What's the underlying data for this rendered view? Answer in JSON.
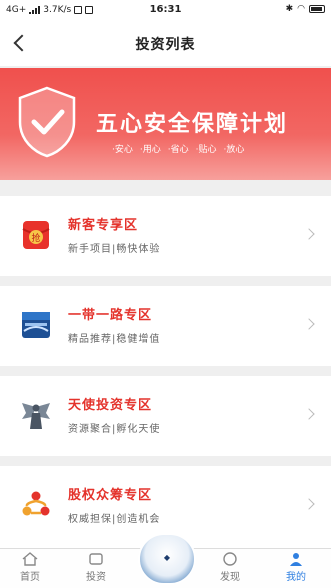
{
  "status_bar": {
    "network": "4G+",
    "speed": "3.7K/s",
    "time": "16:31"
  },
  "nav": {
    "title": "投资列表"
  },
  "banner": {
    "title": "五心安全保障计划",
    "tags": [
      "·安心",
      "·用心",
      "·省心",
      "·贴心",
      "·放心"
    ]
  },
  "cards": [
    {
      "title": "新客专享区",
      "subtitle": "新手项目|畅快体验",
      "icon": "red-packet-icon",
      "icon_text": "抢"
    },
    {
      "title": "一带一路专区",
      "subtitle": "精品推荐|稳健增值",
      "icon": "belt-road-icon"
    },
    {
      "title": "天使投资专区",
      "subtitle": "资源聚合|孵化天使",
      "icon": "angel-icon"
    },
    {
      "title": "股权众筹专区",
      "subtitle": "权威担保|创造机会",
      "icon": "equity-icon"
    }
  ],
  "tabs": [
    {
      "label": "首页",
      "active": false
    },
    {
      "label": "投资",
      "active": false
    },
    {
      "label": "发现",
      "active": false
    },
    {
      "label": "我的",
      "active": true
    }
  ],
  "colors": {
    "accent_red": "#e4332c",
    "tab_active": "#2f7fe0"
  }
}
